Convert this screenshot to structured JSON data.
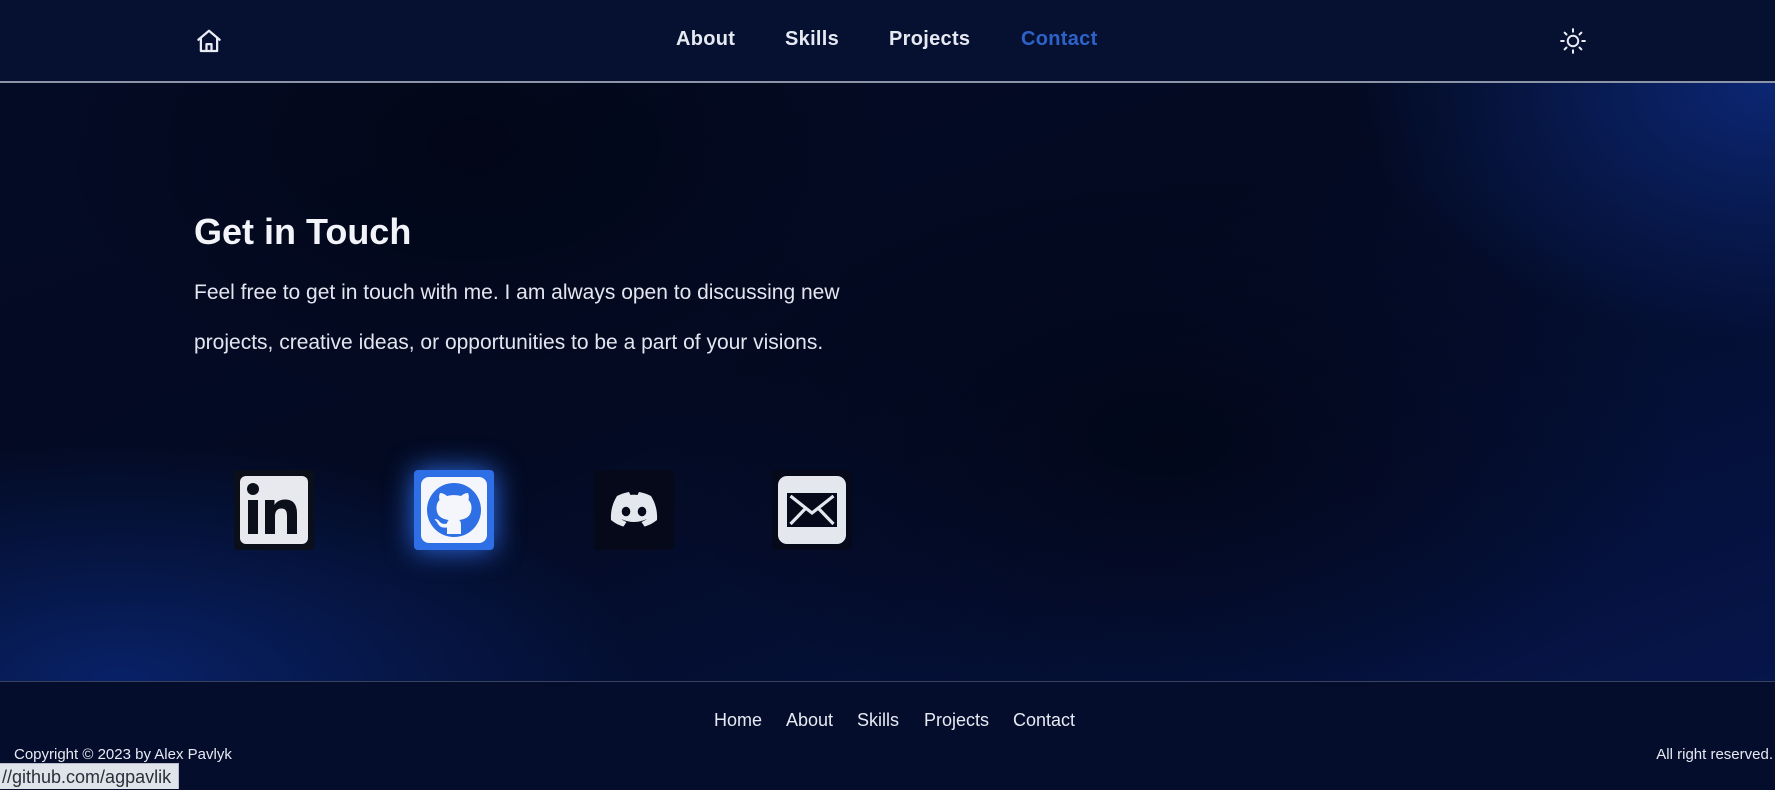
{
  "header": {
    "home_icon": "home-icon",
    "nav": [
      {
        "label": "About",
        "active": false
      },
      {
        "label": "Skills",
        "active": false
      },
      {
        "label": "Projects",
        "active": false
      },
      {
        "label": "Contact",
        "active": true
      }
    ],
    "theme_icon": "sun-icon",
    "active_color": "#2d63c8"
  },
  "contact": {
    "title": "Get in Touch",
    "text": "Feel free to get in touch with me. I am always open to discussing new projects, creative ideas, or opportunities to be a part of your visions.",
    "socials": [
      {
        "name": "linkedin",
        "icon": "linkedin-icon"
      },
      {
        "name": "github",
        "icon": "github-icon",
        "highlighted": true
      },
      {
        "name": "discord",
        "icon": "discord-icon"
      },
      {
        "name": "email",
        "icon": "mail-icon"
      }
    ],
    "highlight_color": "#2f6fe6"
  },
  "footer": {
    "links": [
      "Home",
      "About",
      "Skills",
      "Projects",
      "Contact"
    ],
    "copyright": "Copyright © 2023 by Alex Pavlyk",
    "rights": "All right reserved."
  },
  "status_bar": {
    "url": "//github.com/agpavlik"
  }
}
